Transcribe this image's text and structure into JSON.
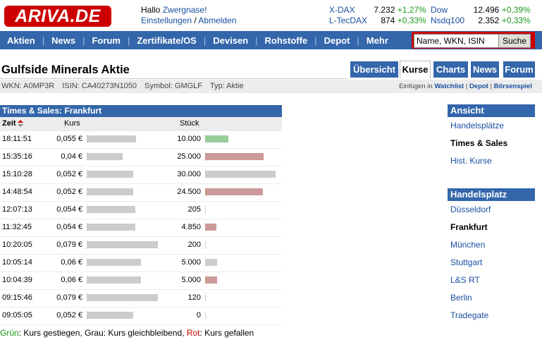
{
  "brand": {
    "logo": "ARIVA.DE",
    "color": "#cc0000"
  },
  "header": {
    "greeting": "Hallo",
    "username": "Zwergnase!",
    "settings": "Einstellungen",
    "sep": "/",
    "logout": "Abmelden"
  },
  "indices": [
    {
      "name": "X-DAX",
      "value": "7.232",
      "change": "+1,27%"
    },
    {
      "name": "L-TecDAX",
      "value": "874",
      "change": "+0,33%"
    },
    {
      "name": "Dow",
      "value": "12.496",
      "change": "+0,39%"
    },
    {
      "name": "Nsdq100",
      "value": "2.352",
      "change": "+0,33%"
    }
  ],
  "nav": {
    "items": [
      "Aktien",
      "News",
      "Forum",
      "Zertifikate/OS",
      "Devisen",
      "Rohstoffe",
      "Depot",
      "Mehr"
    ],
    "separator": "|",
    "search_placeholder": "Name, WKN, ISIN",
    "search_button": "Suche"
  },
  "page": {
    "title": "Gulfside Minerals Aktie",
    "tabs": [
      {
        "label": "Übersicht",
        "active": false
      },
      {
        "label": "Kurse",
        "active": true
      },
      {
        "label": "Charts",
        "active": false
      },
      {
        "label": "News",
        "active": false
      },
      {
        "label": "Forum",
        "active": false
      }
    ],
    "meta": {
      "wkn": "WKN: A0MP3R",
      "isin": "ISIN: CA40273N1050",
      "symbol": "Symbol: GMGLF",
      "typ": "Typ: Aktie",
      "insert_prefix": "Einfügen in",
      "watchlist": "Watchlist",
      "sep": "|",
      "depot": "Depot",
      "boersenspiel": "Börsenspiel"
    }
  },
  "times_sales": {
    "title": "Times & Sales: Frankfurt",
    "columns": {
      "time": "Zeit",
      "price": "Kurs",
      "qty": "Stück"
    },
    "rows": [
      {
        "time": "18:11:51",
        "price": "0,055 €",
        "price_val": 0.055,
        "qty": "10.000",
        "qty_val": 10000,
        "trend": "up"
      },
      {
        "time": "15:35:16",
        "price": "0,04 €",
        "price_val": 0.04,
        "qty": "25.000",
        "qty_val": 25000,
        "trend": "down"
      },
      {
        "time": "15:10:28",
        "price": "0,052 €",
        "price_val": 0.052,
        "qty": "30.000",
        "qty_val": 30000,
        "trend": "same"
      },
      {
        "time": "14:48:54",
        "price": "0,052 €",
        "price_val": 0.052,
        "qty": "24.500",
        "qty_val": 24500,
        "trend": "down"
      },
      {
        "time": "12:07:13",
        "price": "0,054 €",
        "price_val": 0.054,
        "qty": "205",
        "qty_val": 205,
        "trend": "same"
      },
      {
        "time": "11:32:45",
        "price": "0,054 €",
        "price_val": 0.054,
        "qty": "4.850",
        "qty_val": 4850,
        "trend": "down"
      },
      {
        "time": "10:20:05",
        "price": "0,079 €",
        "price_val": 0.079,
        "qty": "200",
        "qty_val": 200,
        "trend": "same"
      },
      {
        "time": "10:05:14",
        "price": "0,06 €",
        "price_val": 0.06,
        "qty": "5.000",
        "qty_val": 5000,
        "trend": "same"
      },
      {
        "time": "10:04:39",
        "price": "0,06 €",
        "price_val": 0.06,
        "qty": "5.000",
        "qty_val": 5000,
        "trend": "down"
      },
      {
        "time": "09:15:46",
        "price": "0,079 €",
        "price_val": 0.079,
        "qty": "120",
        "qty_val": 120,
        "trend": "same"
      },
      {
        "time": "09:05:05",
        "price": "0,052 €",
        "price_val": 0.052,
        "qty": "0",
        "qty_val": 0,
        "trend": "same"
      }
    ],
    "colors": {
      "up": "#99cc99",
      "down": "#cc9999",
      "same": "#cccccc"
    }
  },
  "legend": {
    "green_word": "Grün",
    "green_text": ": Kurs gestiegen, Grau: Kurs gleichbleibend, ",
    "red_word": "Rot",
    "red_text": ": Kurs gefallen",
    "green_color": "#1a9a1a",
    "red_color": "#cc0000"
  },
  "sidebar": {
    "ansicht": {
      "title": "Ansicht",
      "items": [
        {
          "label": "Handelsplätze",
          "current": false
        },
        {
          "label": "Times & Sales",
          "current": true
        },
        {
          "label": "Hist. Kurse",
          "current": false
        }
      ]
    },
    "handelsplatz": {
      "title": "Handelsplatz",
      "items": [
        {
          "label": "Düsseldorf",
          "current": false
        },
        {
          "label": "Frankfurt",
          "current": true
        },
        {
          "label": "München",
          "current": false
        },
        {
          "label": "Stuttgart",
          "current": false
        },
        {
          "label": "L&S RT",
          "current": false
        },
        {
          "label": "Berlin",
          "current": false
        },
        {
          "label": "Tradegate",
          "current": false
        }
      ]
    }
  }
}
